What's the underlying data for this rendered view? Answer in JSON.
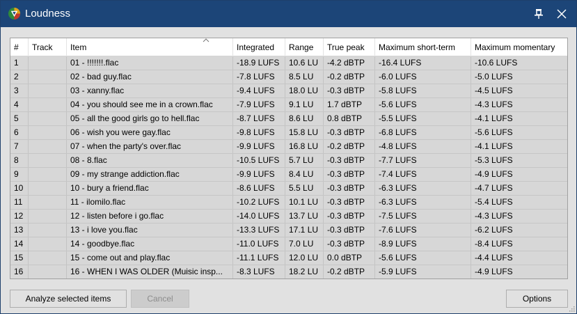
{
  "window": {
    "title": "Loudness"
  },
  "columns": [
    "#",
    "Track",
    "Item",
    "Integrated",
    "Range",
    "True peak",
    "Maximum short-term",
    "Maximum momentary"
  ],
  "rows": [
    [
      "1",
      "",
      "01 - !!!!!!!.flac",
      "-18.9 LUFS",
      "10.6 LU",
      "-4.2 dBTP",
      "-16.4 LUFS",
      "-10.6 LUFS"
    ],
    [
      "2",
      "",
      "02 - bad guy.flac",
      "-7.8 LUFS",
      "8.5 LU",
      "-0.2 dBTP",
      "-6.0 LUFS",
      "-5.0 LUFS"
    ],
    [
      "3",
      "",
      "03 - xanny.flac",
      "-9.4 LUFS",
      "18.0 LU",
      "-0.3 dBTP",
      "-5.8 LUFS",
      "-4.5 LUFS"
    ],
    [
      "4",
      "",
      "04 - you should see me in a crown.flac",
      "-7.9 LUFS",
      "9.1 LU",
      "1.7 dBTP",
      "-5.6 LUFS",
      "-4.3 LUFS"
    ],
    [
      "5",
      "",
      "05 - all the good girls go to hell.flac",
      "-8.7 LUFS",
      "8.6 LU",
      "0.8 dBTP",
      "-5.5 LUFS",
      "-4.1 LUFS"
    ],
    [
      "6",
      "",
      "06 - wish you were gay.flac",
      "-9.8 LUFS",
      "15.8 LU",
      "-0.3 dBTP",
      "-6.8 LUFS",
      "-5.6 LUFS"
    ],
    [
      "7",
      "",
      "07 - when the party's over.flac",
      "-9.9 LUFS",
      "16.8 LU",
      "-0.2 dBTP",
      "-4.8 LUFS",
      "-4.1 LUFS"
    ],
    [
      "8",
      "",
      "08 - 8.flac",
      "-10.5 LUFS",
      "5.7 LU",
      "-0.3 dBTP",
      "-7.7 LUFS",
      "-5.3 LUFS"
    ],
    [
      "9",
      "",
      "09 - my strange addiction.flac",
      "-9.9 LUFS",
      "8.4 LU",
      "-0.3 dBTP",
      "-7.4 LUFS",
      "-4.9 LUFS"
    ],
    [
      "10",
      "",
      "10 - bury a friend.flac",
      "-8.6 LUFS",
      "5.5 LU",
      "-0.3 dBTP",
      "-6.3 LUFS",
      "-4.7 LUFS"
    ],
    [
      "11",
      "",
      "11 - ilomilo.flac",
      "-10.2 LUFS",
      "10.1 LU",
      "-0.3 dBTP",
      "-6.3 LUFS",
      "-5.4 LUFS"
    ],
    [
      "12",
      "",
      "12 - listen before i go.flac",
      "-14.0 LUFS",
      "13.7 LU",
      "-0.3 dBTP",
      "-7.5 LUFS",
      "-4.3 LUFS"
    ],
    [
      "13",
      "",
      "13 - i love you.flac",
      "-13.3 LUFS",
      "17.1 LU",
      "-0.3 dBTP",
      "-7.6 LUFS",
      "-6.2 LUFS"
    ],
    [
      "14",
      "",
      "14 - goodbye.flac",
      "-11.0 LUFS",
      "7.0 LU",
      "-0.3 dBTP",
      "-8.9 LUFS",
      "-8.4 LUFS"
    ],
    [
      "15",
      "",
      "15 - come out and play.flac",
      "-11.1 LUFS",
      "12.0 LU",
      "0.0 dBTP",
      "-5.6 LUFS",
      "-4.4 LUFS"
    ],
    [
      "16",
      "",
      "16 - WHEN I WAS OLDER (Muisic insp...",
      "-8.3 LUFS",
      "18.2 LU",
      "-0.2 dBTP",
      "-5.9 LUFS",
      "-4.9 LUFS"
    ]
  ],
  "buttons": {
    "analyze": "Analyze selected items",
    "cancel": "Cancel",
    "options": "Options"
  },
  "icons": {
    "app": "reaper-logo-icon",
    "pin": "pin-icon",
    "close": "close-icon",
    "sort": "sort-ascending-icon",
    "grip": "resize-grip-icon"
  },
  "colors": {
    "titlebar": "#1c4578",
    "row_bg": "#d7d7d7",
    "window_bg": "#e1e1e1"
  }
}
